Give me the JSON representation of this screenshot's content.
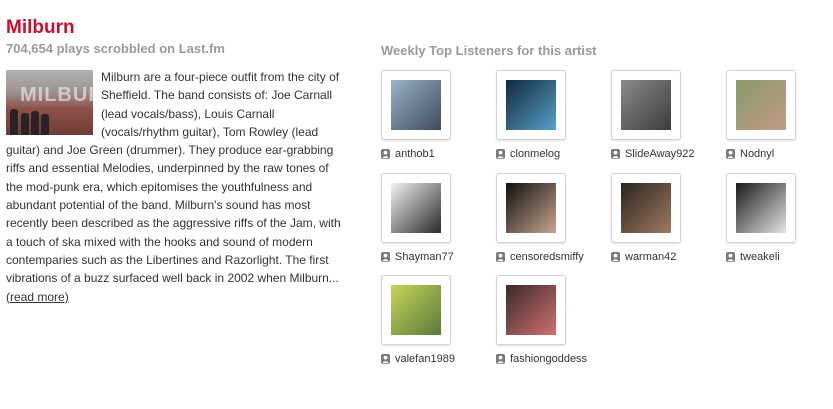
{
  "artist": {
    "name": "Milburn",
    "plays": "704,654 plays scrobbled on Last.fm",
    "image_watermark": "MILBURN",
    "bio": "Milburn are a four-piece outfit from the city of Sheffield. The band consists of: Joe Carnall (lead vocals/bass), Louis Carnall (vocals/rhythm guitar), Tom Rowley (lead guitar) and Joe Green (drummer). They produce ear-grabbing riffs and essential Melodies, underpinned by the raw tones of the mod-punk era, which epitomises the youthfulness and abundant potential of the band. Milburn's sound has most recently been described as the aggressive riffs of the Jam, with a touch of ska mixed with the hooks and sound of modern contemparies such as the Libertines and Razorlight. The first vibrations of a buzz surfaced well back in 2002 when Milburn...",
    "read_more": "(read more)"
  },
  "listeners": {
    "title": "Weekly Top Listeners for this artist",
    "users": [
      {
        "name": "anthob1",
        "colors": [
          "#9bb3c7",
          "#3d4a5c"
        ]
      },
      {
        "name": "clonmelog",
        "colors": [
          "#0f2a3c",
          "#5aa0c9"
        ]
      },
      {
        "name": "SlideAway922",
        "colors": [
          "#8a8a8a",
          "#3c3c3c"
        ]
      },
      {
        "name": "Nodnyl",
        "colors": [
          "#8a9a6a",
          "#c29a86"
        ]
      },
      {
        "name": "Shayman77",
        "colors": [
          "#f2f2f2",
          "#2b2b2b"
        ]
      },
      {
        "name": "censoredsmiffy",
        "colors": [
          "#101010",
          "#c8a58e"
        ]
      },
      {
        "name": "warman42",
        "colors": [
          "#2b2520",
          "#a07a60"
        ]
      },
      {
        "name": "tweakeli",
        "colors": [
          "#1a1a1a",
          "#e4e4e4"
        ]
      },
      {
        "name": "valefan1989",
        "colors": [
          "#c7d35a",
          "#5a7a3a"
        ]
      },
      {
        "name": "fashiongoddess",
        "colors": [
          "#3a2a2a",
          "#d07070"
        ]
      }
    ]
  },
  "colors": {
    "accent": "#c8102e",
    "muted": "#9a9a9a",
    "text": "#333333"
  },
  "icons": {
    "user": "user-silhouette-icon"
  }
}
